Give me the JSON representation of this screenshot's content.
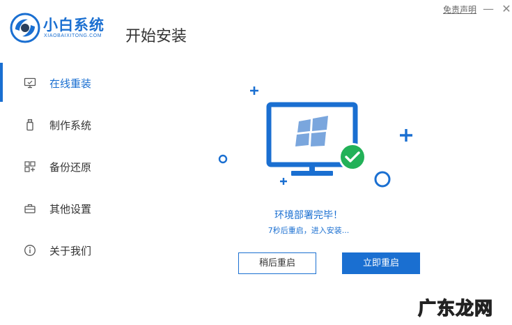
{
  "header": {
    "brand_name": "小白系统",
    "brand_sub": "XIAOBAIXITONG.COM",
    "page_title": "开始安装",
    "disclaimer_label": "免责声明",
    "minimize_glyph": "—",
    "close_glyph": "✕"
  },
  "sidebar": {
    "items": [
      {
        "label": "在线重装",
        "icon": "monitor-icon",
        "active": true
      },
      {
        "label": "制作系统",
        "icon": "usb-drive-icon",
        "active": false
      },
      {
        "label": "备份还原",
        "icon": "backup-grid-icon",
        "active": false
      },
      {
        "label": "其他设置",
        "icon": "toolbox-icon",
        "active": false
      },
      {
        "label": "关于我们",
        "icon": "info-icon",
        "active": false
      }
    ]
  },
  "main": {
    "status_title": "环境部署完毕！",
    "status_subtitle": "7秒后重启，进入安装...",
    "later_button_label": "稍后重启",
    "now_button_label": "立即重启"
  },
  "watermark": {
    "text": "广东龙网"
  },
  "colors": {
    "accent": "#1a6fd1",
    "success": "#22b158",
    "text": "#333333"
  }
}
